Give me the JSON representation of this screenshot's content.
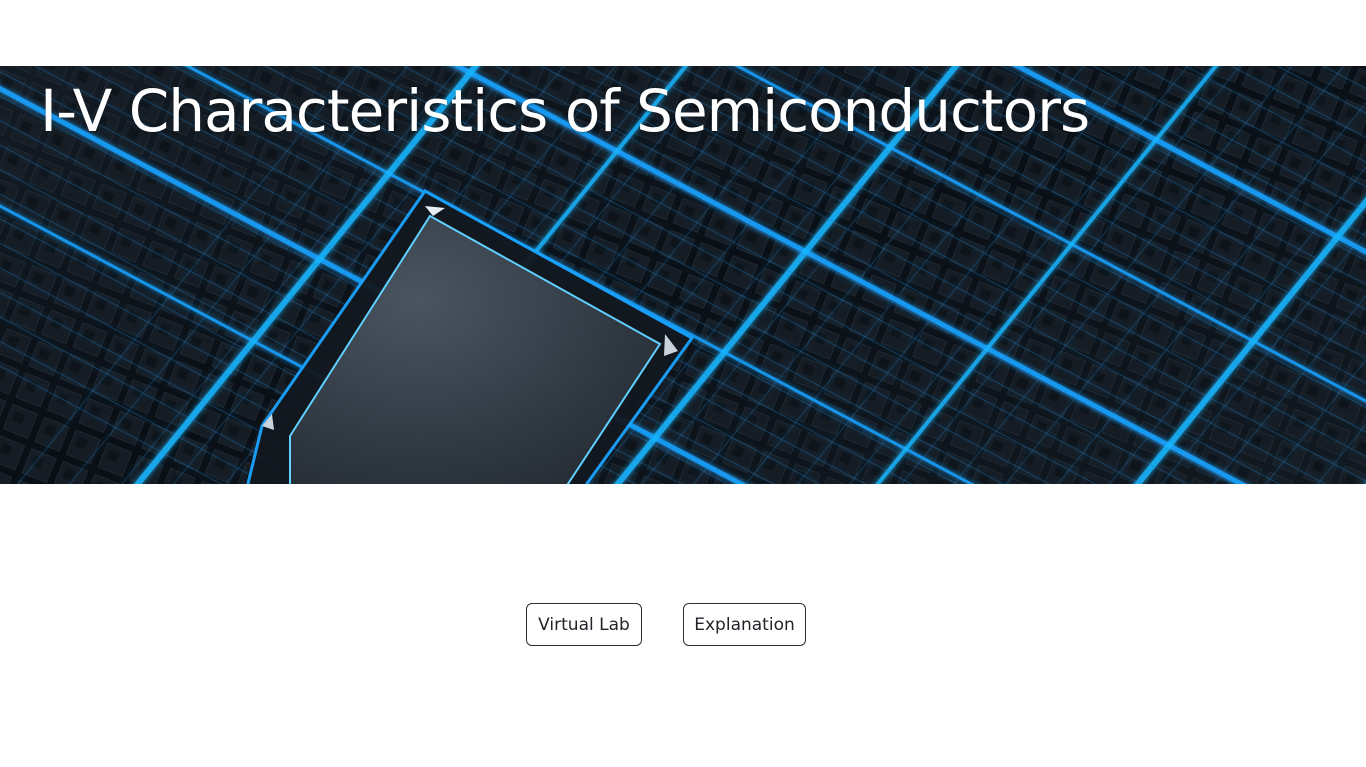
{
  "hero": {
    "title": "I-V Characteristics of Semiconductors",
    "image_description_icon": "circuit-chip-image",
    "colors": {
      "background": "#0b1016",
      "glow": "#1aa3ff",
      "chip": "#2a323c"
    }
  },
  "actions": {
    "virtual_lab_label": "Virtual Lab",
    "explanation_label": "Explanation"
  }
}
